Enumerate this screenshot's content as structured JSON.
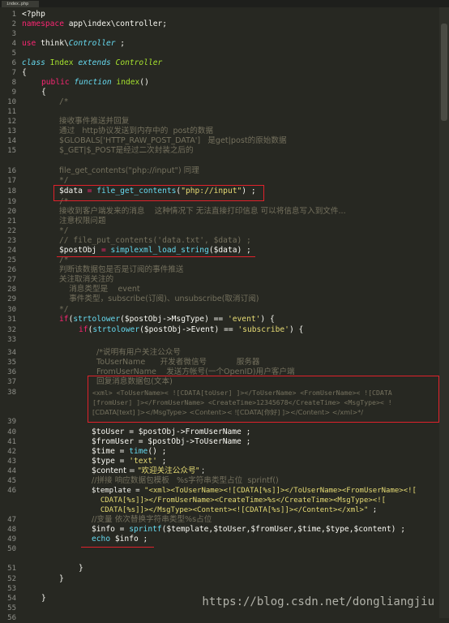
{
  "tab": {
    "filename": "index.php"
  },
  "watermark": "https://blog.csdn.net/dongliangjiu",
  "colors": {
    "background": "#272822",
    "keyword": "#f92672",
    "string": "#e6db74",
    "comment": "#75715e",
    "class": "#a6e22e",
    "function": "#66d9ef",
    "annotation": "#e0212b"
  },
  "line_numbers": [
    "1",
    "2",
    "3",
    "4",
    "5",
    "6",
    "7",
    "8",
    "9",
    "10",
    "11",
    "12",
    "13",
    "14",
    "15",
    "16",
    "17",
    "18",
    "19",
    "20",
    "21",
    "22",
    "23",
    "24",
    "25",
    "26",
    "27",
    "28",
    "29",
    "30",
    "31",
    "32",
    "33",
    "34",
    "35",
    "36",
    "37",
    "38",
    "39",
    "40",
    "41",
    "42",
    "43",
    "44",
    "45",
    "46",
    "47",
    "48",
    "49",
    "50",
    "51",
    "52",
    "53",
    "54",
    "55",
    "56"
  ],
  "code": {
    "l1": "<?php",
    "l2_kw": "namespace",
    "l2_rest": " app\\index\\controller;",
    "l4_kw": "use",
    "l4_a": " think\\",
    "l4_b": "Controller",
    "l4_c": " ;",
    "l6_kw": "class",
    "l6_a": " Index ",
    "l6_kw2": "extends",
    "l6_b": " Controller",
    "l7": "{",
    "l8_kw": "public",
    "l8_fn": " function",
    "l8_name": " index",
    "l8_rest": "()",
    "l9": "{",
    "l10": "/*",
    "l12": "接收事件推送并回复",
    "l13": "通过   http协议发送到内存中的  post的数据",
    "l14": "$GLOBALS['HTTP_RAW_POST_DATA']   是get|post的原始数据",
    "l15": "$_GET|$_POST是经过二次封装之后的",
    "l16": "file_get_contents(\"php://input\") 同理",
    "l17": "*/",
    "l18_a": "$data",
    "l18_b": " = ",
    "l18_c": "file_get_contents",
    "l18_d": "(",
    "l18_e": "\"php://input\"",
    "l18_f": ") ;",
    "l19": "/*",
    "l20": "接收到客户端发来的消息    这种情况下 无法直接打印信息 可以将信息写入到文件...",
    "l21": "注意权限问题",
    "l22": "*/",
    "l23": "// file_put_contents('data.txt', $data) ;",
    "l24_a": "$postObj",
    "l24_b": " = ",
    "l24_c": "simplexml_load_string",
    "l24_d": "($data) ;",
    "l25": "/*",
    "l26": "判断该数据包是否是订阅的事件推送",
    "l27": "关注取消关注的",
    "l28": "    消息类型是    event",
    "l29": "    事件类型，subscribe(订阅)、unsubscribe(取消订阅)",
    "l30": "*/",
    "l31_kw": "if",
    "l31_a": "(",
    "l31_fn": "strtolower",
    "l31_b": "($postObj->MsgType) == ",
    "l31_s": "'event'",
    "l31_c": ") {",
    "l32_kw": "if",
    "l32_a": "(",
    "l32_fn": "strtolower",
    "l32_b": "($postObj->Event) == ",
    "l32_s": "'subscribe'",
    "l32_c": ") {",
    "l34": "/*说明有用户关注公众号",
    "l35": "ToUserName      开发者微信号            服务器",
    "l36": "FromUserName    发送方帐号(一个OpenID)用户客户端",
    "l37": "回复消息数据包(文本)",
    "l38a": "<xml> <ToUserName>< ![CDATA[toUser] ]></ToUserName> <FromUserName>< ![CDATA",
    "l38b": "[fromUser] ]></FromUserName> <CreateTime>12345678</CreateTime> <MsgType>< !",
    "l38c": "[CDATA[text] ]></MsgType> <Content>< ![CDATA[你好] ]></Content> </xml>*/",
    "l40": "$toUser = $postObj->FromUserName ;",
    "l41": "$fromUser = $postObj->ToUserName ;",
    "l42_a": "$time = ",
    "l42_fn": "time",
    "l42_b": "() ;",
    "l43_a": "$type = ",
    "l43_s": "'text'",
    "l43_b": " ;",
    "l44_a": "$content = ",
    "l44_s": "\"欢迎关注公众号\"",
    "l44_b": " ;",
    "l45": "//拼接 响应数据包模板   %s字符串类型占位  sprintf()",
    "l46a_a": "$template = ",
    "l46a_s": "\"<xml><ToUserName><![CDATA[%s]]></ToUserName><FromUserName><![",
    "l46b": "  CDATA[%s]]></FromUserName><CreateTime>%s</CreateTime><MsgType><![",
    "l46c_s": "  CDATA[%s]]></MsgType><Content><![CDATA[%s]]></Content></xml>\"",
    "l46c_b": " ;",
    "l47": "//变量 依次替换字符串类型%s占位",
    "l48_a": "$info = ",
    "l48_fn": "sprintf",
    "l48_b": "($template,$toUser,$fromUser,$time,$type,$content) ;",
    "l49_kw": "echo",
    "l49_a": " $info ;",
    "l51": "}",
    "l52": "}",
    "l55": "}"
  }
}
